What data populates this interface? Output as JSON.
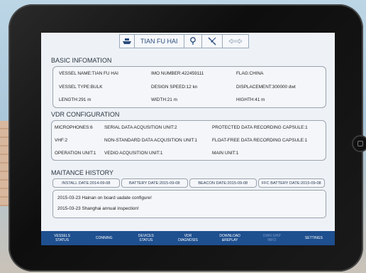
{
  "header": {
    "vessel_name": "TIAN FU HAI",
    "icons": [
      "ship-icon",
      "balloon-icon",
      "satellite-icon",
      "arrows-icon"
    ]
  },
  "basic": {
    "title": "BASIC INFOMATION",
    "vessel_name": "VESSEL NAME:TIAN FU HAI",
    "imo": "IMO NUMBER:422459111",
    "flag": "FLAG:CHINA",
    "vessel_type": "VESSEL TYPE:BULK",
    "design_speed": "DESIGN SPEED:12 kn",
    "displacement": "DISPLACEMENT:300000 dwt",
    "length": "LENGTH:291 m",
    "width": "WIDTH:21 m",
    "height": "HIGHTH:41 m"
  },
  "vdr": {
    "title": "VDR CONFIGURATION",
    "microphones": "MICROPHONES:6",
    "serial": "SERIAL DATA ACQUSITION UNIT:2",
    "protected": "PROTECTED DATA RECORDING CAPSULE:1",
    "vhf": "VHF:2",
    "nonstandard": "NON-STANDARD DATA  ACQUSITION UNIT:1",
    "floatfree": "FLOAT-FREE DATA RECORDING CAPSULE:1",
    "operation": "OPERATION UNIT:1",
    "video": "VEDIO ACQUSITION UNIT:1",
    "main": "MAIN UNIT:1"
  },
  "maint": {
    "title": "MAITANCE HISTORY",
    "dates": [
      "INSTALL DATE:2014-09-08",
      "BATTERY DATE:2015-09-08",
      "BEACON DATE:2015-09-08",
      "FFC BATTERY DATE:2015-09-08"
    ],
    "log": [
      "2015-03-23 Hainan on board uadate configure!",
      "2015-03-23 Shanghai annual inspection!"
    ]
  },
  "nav": [
    {
      "label": "VESSELS\nSTATUS",
      "enabled": true
    },
    {
      "label": "CONNING",
      "enabled": true
    },
    {
      "label": "DEVICES\nSTATUS",
      "enabled": true
    },
    {
      "label": "VDR\nDIAGNOSIS",
      "enabled": true
    },
    {
      "label": "DOWNLOAD\n&REPLAY",
      "enabled": true
    },
    {
      "label": "OWN SHIP\nINFO",
      "enabled": false
    },
    {
      "label": "SETTINGS",
      "enabled": true
    }
  ],
  "colors": {
    "nav_bg": "#1e4f8f",
    "screen_bg": "#eef2f7",
    "accent": "#2a4d7e"
  }
}
